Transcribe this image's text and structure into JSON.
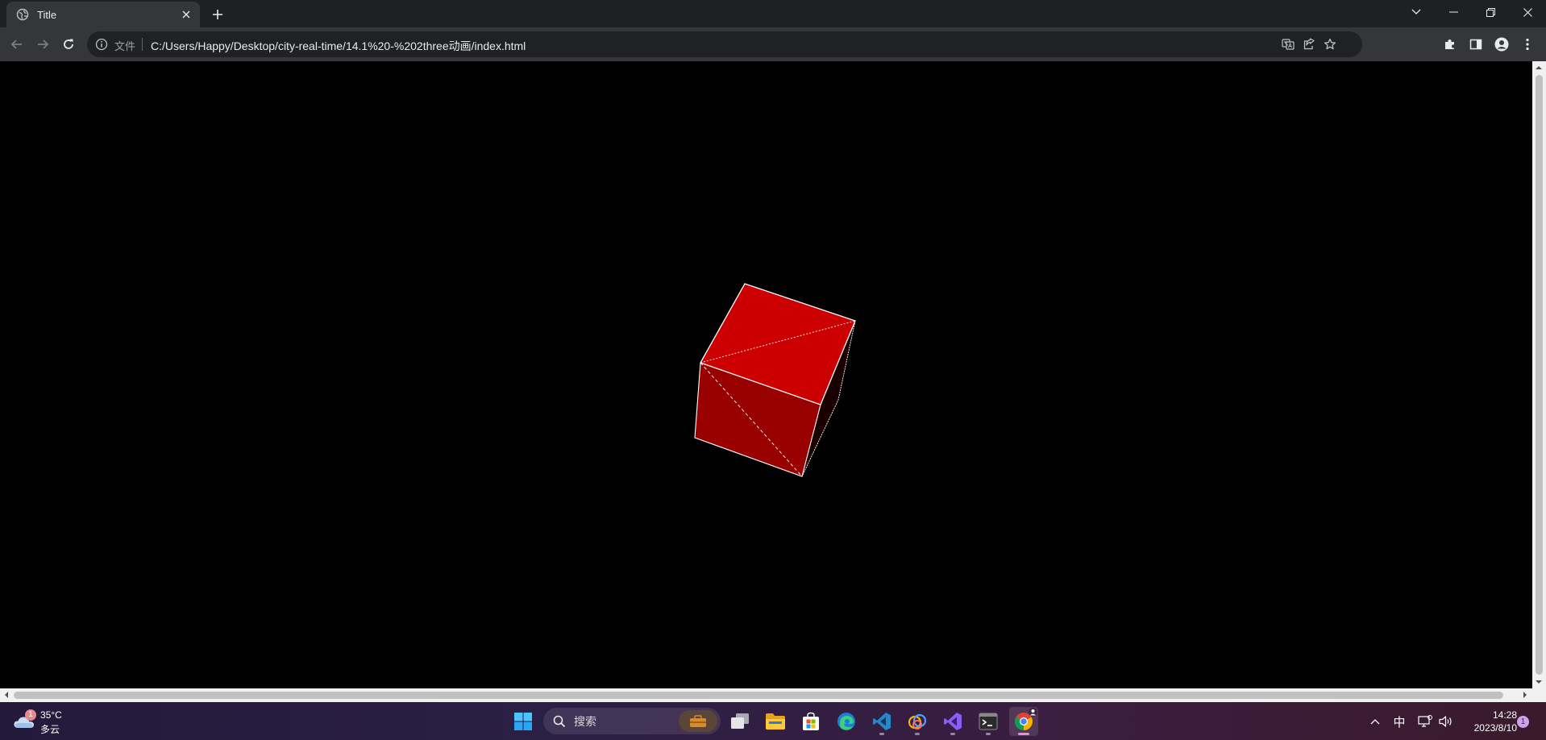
{
  "browser": {
    "tab": {
      "title": "Title"
    },
    "address_bar": {
      "security_chip": "文件",
      "url": "C:/Users/Happy/Desktop/city-real-time/14.1%20-%202three动画/index.html"
    }
  },
  "scene": {
    "background": "#000000",
    "cube_colors": {
      "top": "#cc0000",
      "front": "#990000",
      "edges": "#ffffff"
    }
  },
  "taskbar": {
    "weather": {
      "temperature": "35°C",
      "condition": "多云",
      "badge": "1"
    },
    "search_placeholder": "搜索",
    "tray": {
      "input_method": "中"
    },
    "clock": {
      "time": "14:28",
      "date": "2023/8/10"
    },
    "notification_count": "1"
  }
}
